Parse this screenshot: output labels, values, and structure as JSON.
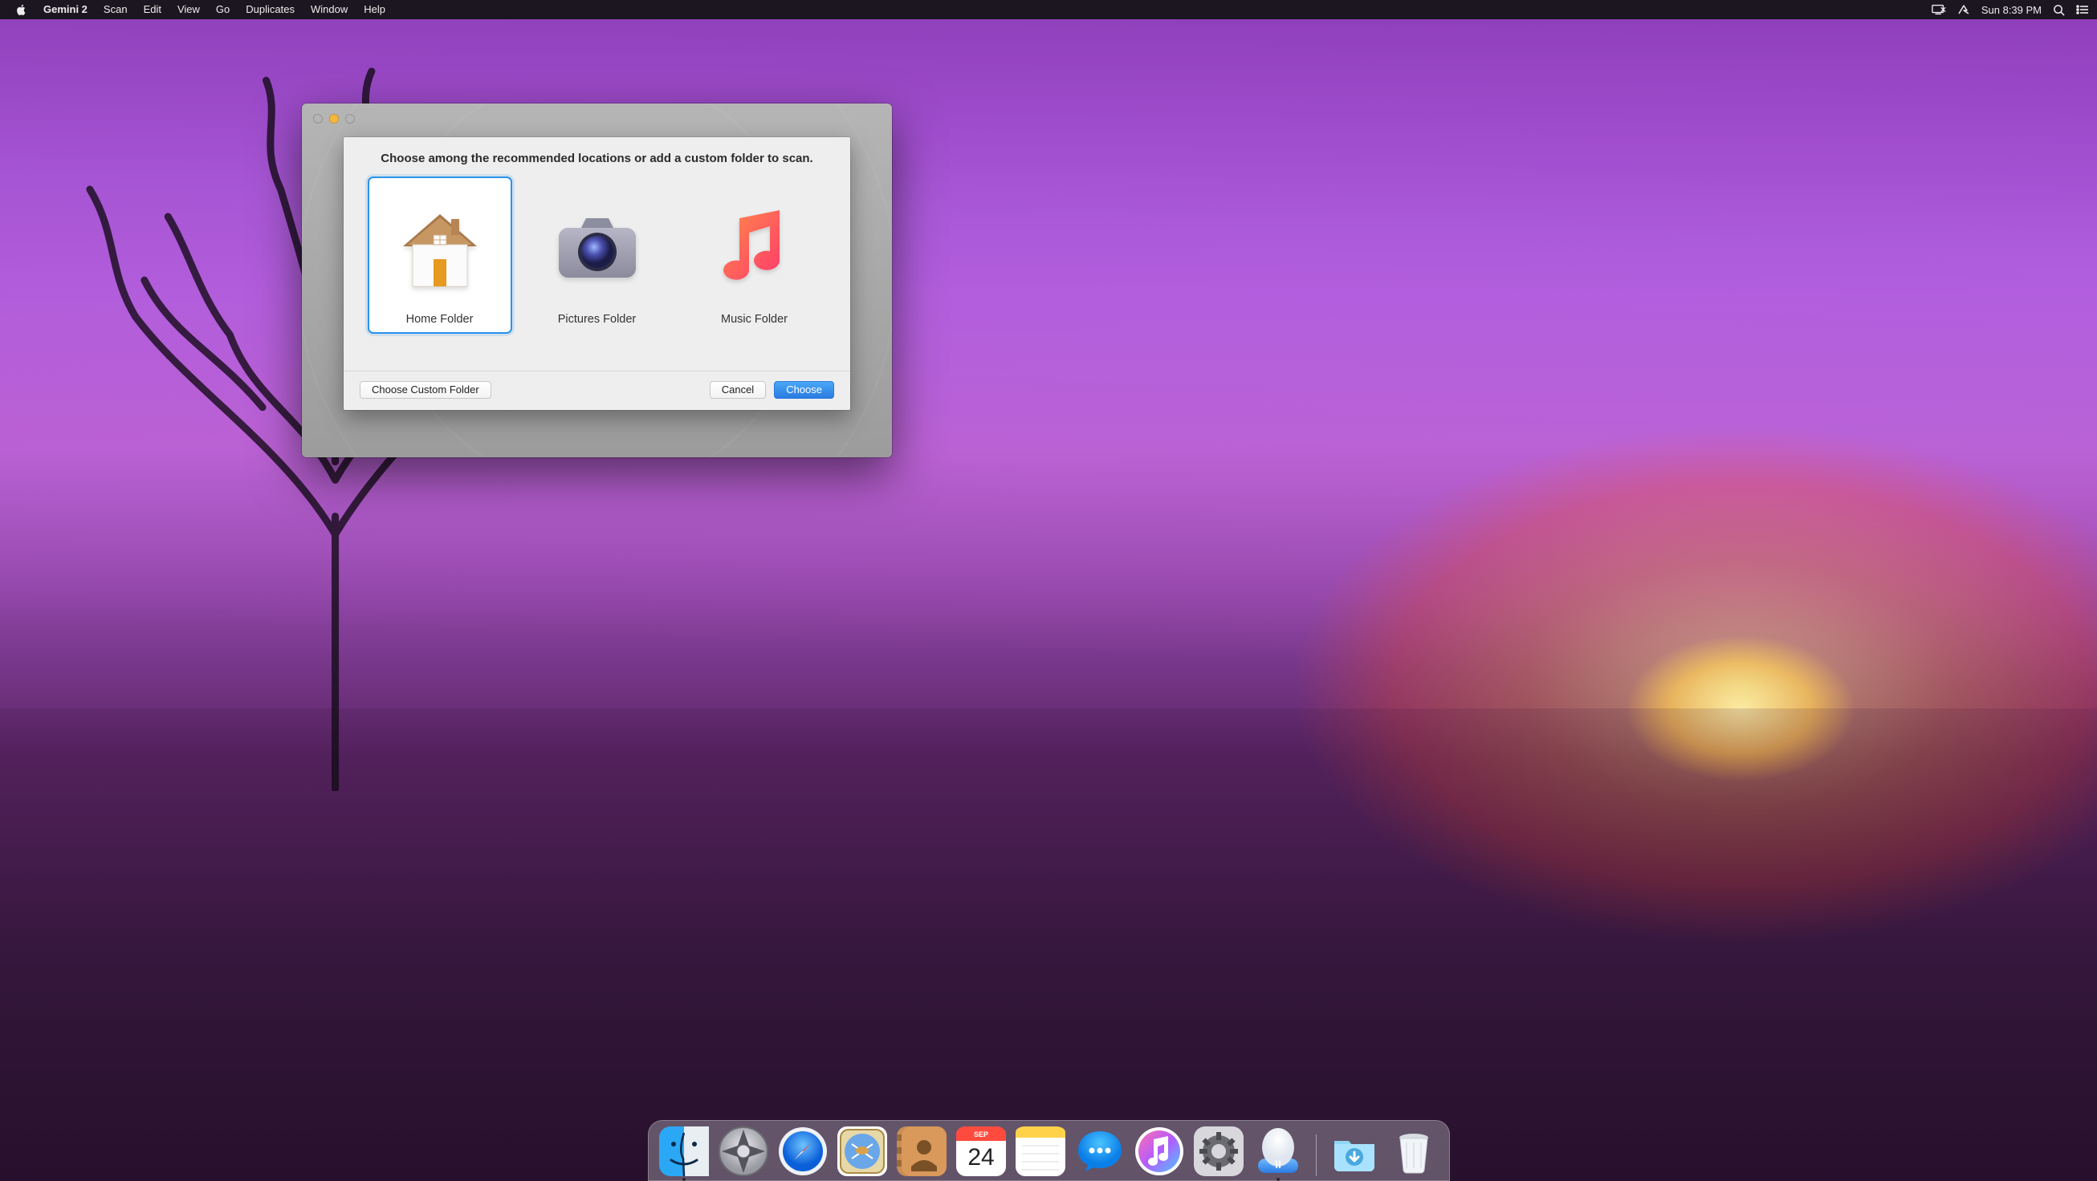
{
  "menubar": {
    "app_name": "Gemini 2",
    "items": [
      "Scan",
      "Edit",
      "View",
      "Go",
      "Duplicates",
      "Window",
      "Help"
    ],
    "clock": "Sun 8:39 PM"
  },
  "window": {
    "sheet_title": "Choose among the recommended locations or add a custom folder to scan.",
    "options": [
      {
        "id": "home",
        "label": "Home Folder",
        "selected": true
      },
      {
        "id": "pictures",
        "label": "Pictures Folder",
        "selected": false
      },
      {
        "id": "music",
        "label": "Music Folder",
        "selected": false
      }
    ],
    "buttons": {
      "custom": "Choose Custom Folder",
      "cancel": "Cancel",
      "choose": "Choose"
    }
  },
  "dock": {
    "apps": [
      {
        "id": "finder",
        "name": "Finder",
        "running": true
      },
      {
        "id": "launchpad",
        "name": "Launchpad",
        "running": false
      },
      {
        "id": "safari",
        "name": "Safari",
        "running": false
      },
      {
        "id": "mail",
        "name": "Mail",
        "running": false
      },
      {
        "id": "contacts",
        "name": "Contacts",
        "running": false
      },
      {
        "id": "calendar",
        "name": "Calendar",
        "running": false,
        "badge_top": "SEP",
        "badge_day": "24"
      },
      {
        "id": "notes",
        "name": "Notes",
        "running": false
      },
      {
        "id": "messages",
        "name": "Messages",
        "running": false
      },
      {
        "id": "itunes",
        "name": "iTunes",
        "running": false
      },
      {
        "id": "settings",
        "name": "System Preferences",
        "running": false
      },
      {
        "id": "gemini",
        "name": "Gemini 2",
        "running": true
      }
    ],
    "right": [
      {
        "id": "downloads",
        "name": "Downloads"
      },
      {
        "id": "trash",
        "name": "Trash"
      }
    ]
  }
}
